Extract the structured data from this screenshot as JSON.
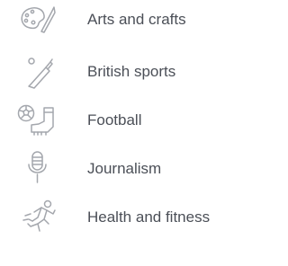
{
  "menu": {
    "items": [
      {
        "label": "Arts and crafts",
        "icon": "palette-icon"
      },
      {
        "label": "British sports",
        "icon": "cricket-bat-icon"
      },
      {
        "label": "Football",
        "icon": "football-boot-icon"
      },
      {
        "label": "Journalism",
        "icon": "microphone-icon"
      },
      {
        "label": "Health and fitness",
        "icon": "running-person-icon"
      }
    ]
  },
  "colors": {
    "icon": "#a4a7ad",
    "text": "#4b4f57",
    "background": "#ffffff"
  }
}
